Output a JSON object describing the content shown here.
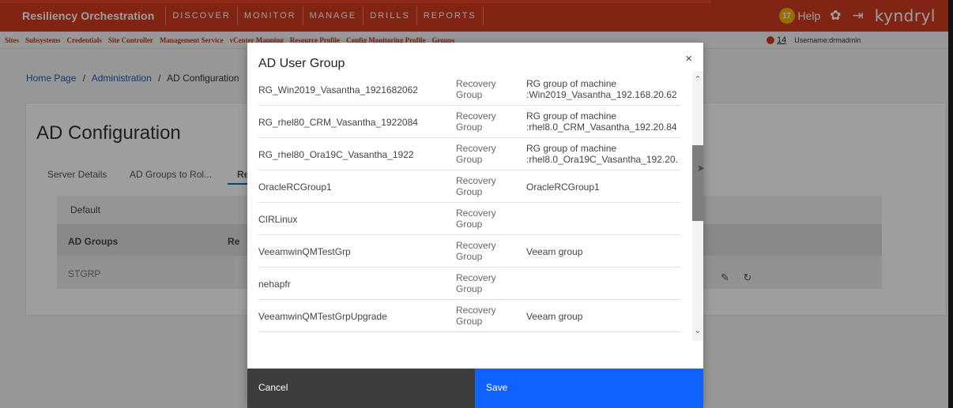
{
  "app": {
    "title": "Resiliency Orchestration",
    "nav": [
      "DISCOVER",
      "MONITOR",
      "MANAGE",
      "DRILLS",
      "REPORTS"
    ],
    "notification_count": "17",
    "help_label": "Help",
    "brand": "kyndryl",
    "accent_color": "#d03b1f"
  },
  "subnav": {
    "items": [
      "Sites",
      "Subsystems",
      "Credentials",
      "Site Controller",
      "Management Service",
      "vCenter Mapping",
      "Resource Profile",
      "Config Monitoring Profile",
      "Groups"
    ],
    "alert_count": "14",
    "username": "Username:drmadmin"
  },
  "background": {
    "breadcrumb": [
      "Home Page",
      "Administration",
      "AD Configuration"
    ],
    "breadcrumb_sep": "/",
    "page_title": "AD Configuration",
    "tabs": [
      "Server Details",
      "AD Groups to Rol...",
      "Re"
    ],
    "table_default": "Default",
    "table_headers": [
      "AD Groups",
      "Re"
    ],
    "table_row": "STGRP"
  },
  "modal": {
    "title": "AD User Group",
    "close_glyph": "×",
    "rows": [
      {
        "name": "RG_Win2019_Vasantha_1921682062",
        "type": [
          "Recovery",
          "Group"
        ],
        "desc": [
          "RG group of machine",
          ":Win2019_Vasantha_192.168.20.62"
        ]
      },
      {
        "name": "RG_rhel80_CRM_Vasantha_1922084",
        "type": [
          "Recovery",
          "Group"
        ],
        "desc": [
          "RG group of machine",
          ":rhel8.0_CRM_Vasantha_192.20.84"
        ]
      },
      {
        "name": "RG_rhel80_Ora19C_Vasantha_1922",
        "type": [
          "Recovery",
          "Group"
        ],
        "desc": [
          "RG group of machine",
          ":rhel8.0_Ora19C_Vasantha_192.20."
        ]
      },
      {
        "name": "OracleRCGroup1",
        "type": [
          "Recovery",
          "Group"
        ],
        "desc": [
          "OracleRCGroup1"
        ]
      },
      {
        "name": "CIRLinux",
        "type": [
          "Recovery",
          "Group"
        ],
        "desc": []
      },
      {
        "name": "VeeamwinQMTestGrp",
        "type": [
          "Recovery",
          "Group"
        ],
        "desc": [
          "Veeam group"
        ]
      },
      {
        "name": "nehapfr",
        "type": [
          "Recovery",
          "Group"
        ],
        "desc": []
      },
      {
        "name": "VeeamwinQMTestGrpUpgrade",
        "type": [
          "Recovery",
          "Group"
        ],
        "desc": [
          "Veeam group"
        ]
      }
    ],
    "cancel_label": "Cancel",
    "save_label": "Save"
  }
}
